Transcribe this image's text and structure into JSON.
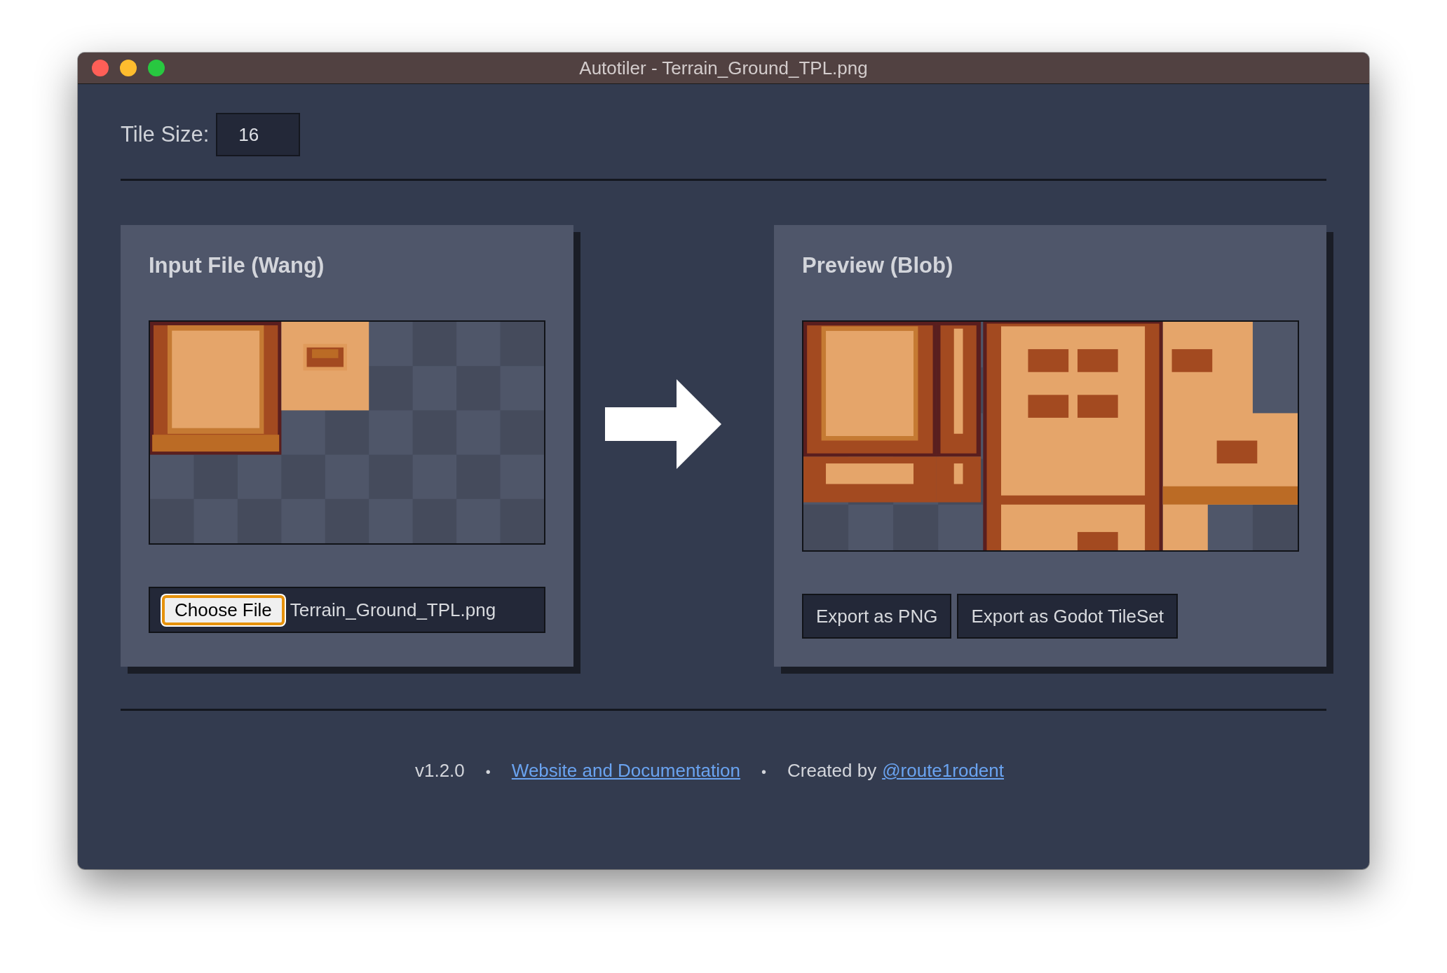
{
  "window": {
    "title": "Autotiler - Terrain_Ground_TPL.png"
  },
  "tile_size": {
    "label": "Tile Size:",
    "value": "16"
  },
  "input_panel": {
    "title": "Input File (Wang)",
    "file_button": "Choose File",
    "file_name": "Terrain_Ground_TPL.png"
  },
  "preview_panel": {
    "title": "Preview (Blob)",
    "buttons": [
      "Export as PNG",
      "Export as Godot TileSet"
    ]
  },
  "footer": {
    "version": "v1.2.0",
    "separator_1": "•",
    "docs_link": "Website and Documentation",
    "separator_2": "•",
    "credit": "Created by",
    "author_link": "@route1rodent"
  }
}
